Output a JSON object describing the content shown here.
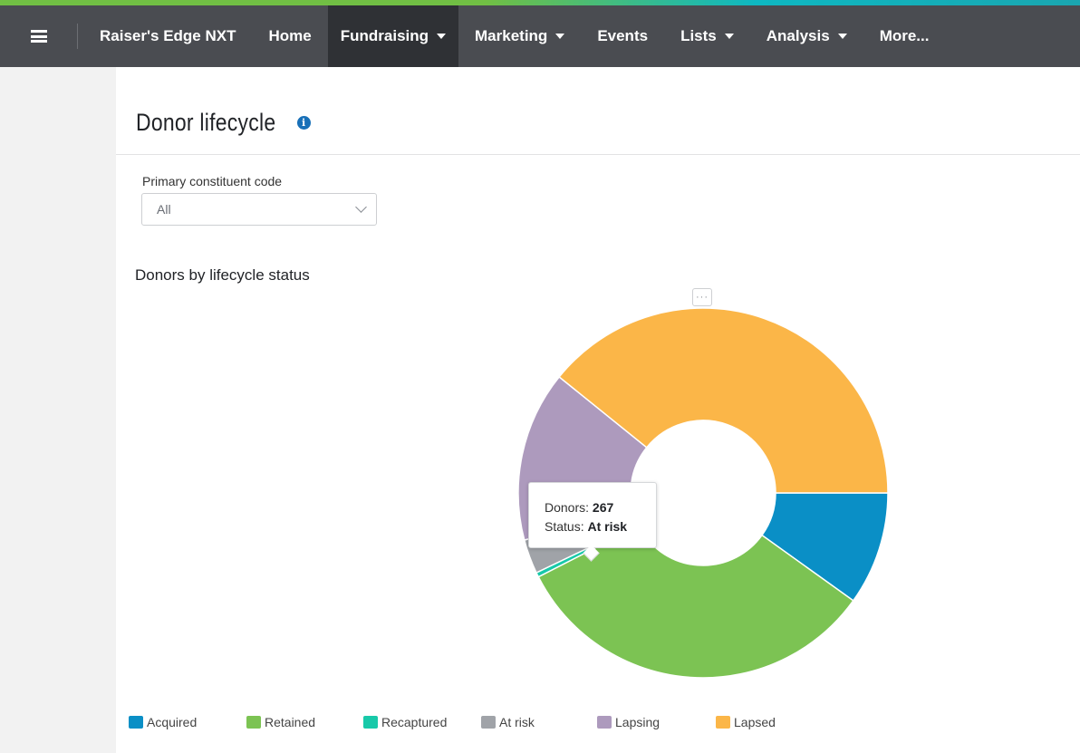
{
  "navbar": {
    "brand": "Raiser's Edge NXT",
    "items": [
      {
        "label": "Home",
        "dropdown": false
      },
      {
        "label": "Fundraising",
        "dropdown": true,
        "active": true
      },
      {
        "label": "Marketing",
        "dropdown": true
      },
      {
        "label": "Events",
        "dropdown": false
      },
      {
        "label": "Lists",
        "dropdown": true
      },
      {
        "label": "Analysis",
        "dropdown": true
      },
      {
        "label": "More...",
        "dropdown": false
      }
    ]
  },
  "page": {
    "title": "Donor lifecycle",
    "info_icon": "info-icon"
  },
  "filter": {
    "label": "Primary constituent code",
    "value": "All"
  },
  "chart": {
    "title": "Donors by lifecycle status",
    "menu_label": "···",
    "tooltip": {
      "donors_label": "Donors:",
      "donors_value": "267",
      "status_label": "Status:",
      "status_value": "At risk"
    }
  },
  "chart_data": {
    "type": "pie",
    "variant": "donut",
    "title": "Donors by lifecycle status",
    "categories": [
      "Acquired",
      "Retained",
      "Recaptured",
      "At risk",
      "Lapsing",
      "Lapsed"
    ],
    "values": [
      9.9,
      32.6,
      0.4,
      3.0,
      14.9,
      39.2
    ],
    "value_unit": "share of donors (%)",
    "colors": [
      "#0a8fc6",
      "#7cc353",
      "#18c9a9",
      "#a0a3a8",
      "#ad9abd",
      "#fbb648"
    ],
    "legend_position": "bottom",
    "highlighted": {
      "category": "At risk",
      "donors": 267
    }
  }
}
